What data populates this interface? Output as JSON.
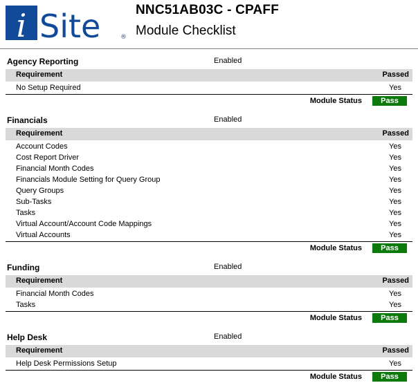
{
  "header": {
    "logo_text": "iSite",
    "logo_mark": "®",
    "title": "NNC51AB03C - CPAFF",
    "subtitle": "Module Checklist"
  },
  "columns": {
    "requirement": "Requirement",
    "passed": "Passed"
  },
  "module_status_label": "Module Status",
  "colors": {
    "logo_blue": "#124a9a",
    "header_gray": "#d9d9d9",
    "pass_green": "#0b7a0b"
  },
  "sections": [
    {
      "name": "Agency Reporting",
      "state": "Enabled",
      "rows": [
        {
          "requirement": "No Setup Required",
          "passed": "Yes"
        }
      ],
      "status": "Pass"
    },
    {
      "name": "Financials",
      "state": "Enabled",
      "rows": [
        {
          "requirement": "Account Codes",
          "passed": "Yes"
        },
        {
          "requirement": "Cost Report Driver",
          "passed": "Yes"
        },
        {
          "requirement": "Financial Month Codes",
          "passed": "Yes"
        },
        {
          "requirement": "Financials Module Setting for Query Group",
          "passed": "Yes"
        },
        {
          "requirement": "Query Groups",
          "passed": "Yes"
        },
        {
          "requirement": "Sub-Tasks",
          "passed": "Yes"
        },
        {
          "requirement": "Tasks",
          "passed": "Yes"
        },
        {
          "requirement": "Virtual Account/Account Code Mappings",
          "passed": "Yes"
        },
        {
          "requirement": "Virtual Accounts",
          "passed": "Yes"
        }
      ],
      "status": "Pass"
    },
    {
      "name": "Funding",
      "state": "Enabled",
      "rows": [
        {
          "requirement": "Financial Month Codes",
          "passed": "Yes"
        },
        {
          "requirement": "Tasks",
          "passed": "Yes"
        }
      ],
      "status": "Pass"
    },
    {
      "name": "Help Desk",
      "state": "Enabled",
      "rows": [
        {
          "requirement": "Help Desk Permissions Setup",
          "passed": "Yes"
        }
      ],
      "status": "Pass"
    }
  ]
}
